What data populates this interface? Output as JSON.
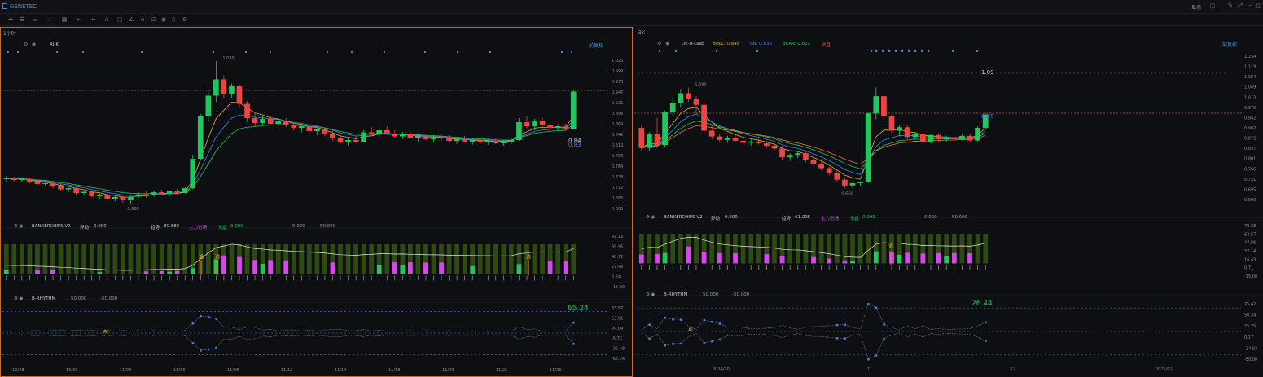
{
  "app": {
    "symbol": "GENETEC",
    "layout_label": "显示"
  },
  "left": {
    "interval": "1小时",
    "adjust": "前复权",
    "indicator_main": "AI-K",
    "high_label": "1.030",
    "low_label": "0.680",
    "price_labels": [
      "0.84",
      "0.83"
    ],
    "y_ticks": [
      "1.025",
      "0.999",
      "0.973",
      "0.947",
      "0.921",
      "0.895",
      "0.869",
      "0.842",
      "0.816",
      "0.790",
      "0.764",
      "0.738",
      "0.712",
      "0.686",
      "0.660"
    ],
    "sub1": {
      "name": "BANKERCHIPS-V2",
      "f1": "异动",
      "v1": "0.000",
      "f2": "趋势",
      "v2": "80.686",
      "f3": "主力进场",
      "f4": "洗盘",
      "v4": "0.000",
      "v5": "0.000",
      "v6": "50.000",
      "ticks": [
        "91.19",
        "69.95",
        "48.72",
        "27.48",
        "6.24",
        "-15.00"
      ],
      "escape": "逃"
    },
    "sub2": {
      "name": "B-RHYTHM",
      "v1": "50.000",
      "v2": "-50.000",
      "value": "65.24",
      "ticks": [
        "83.57",
        "53.01",
        "24.04",
        "-5.72",
        "-35.48",
        "-65.24"
      ],
      "ai": "AI"
    },
    "x_ticks": [
      "10/28",
      "10/30",
      "11/04",
      "11/06",
      "11/08",
      "11/12",
      "11/14",
      "11/18",
      "11/20",
      "11/22",
      "11/26"
    ],
    "chart_data": {
      "type": "candlestick",
      "ylim": [
        0.66,
        1.04
      ],
      "ohlc": [
        [
          0.74,
          0.748,
          0.735,
          0.742
        ],
        [
          0.742,
          0.746,
          0.735,
          0.738
        ],
        [
          0.738,
          0.745,
          0.732,
          0.74
        ],
        [
          0.74,
          0.744,
          0.73,
          0.733
        ],
        [
          0.733,
          0.738,
          0.725,
          0.728
        ],
        [
          0.728,
          0.735,
          0.722,
          0.73
        ],
        [
          0.73,
          0.734,
          0.718,
          0.722
        ],
        [
          0.722,
          0.728,
          0.712,
          0.715
        ],
        [
          0.715,
          0.722,
          0.708,
          0.718
        ],
        [
          0.718,
          0.72,
          0.702,
          0.706
        ],
        [
          0.706,
          0.712,
          0.7,
          0.709
        ],
        [
          0.709,
          0.712,
          0.695,
          0.698
        ],
        [
          0.698,
          0.705,
          0.69,
          0.702
        ],
        [
          0.702,
          0.706,
          0.688,
          0.692
        ],
        [
          0.692,
          0.7,
          0.685,
          0.696
        ],
        [
          0.696,
          0.702,
          0.682,
          0.688
        ],
        [
          0.688,
          0.7,
          0.68,
          0.697
        ],
        [
          0.697,
          0.708,
          0.692,
          0.703
        ],
        [
          0.703,
          0.71,
          0.695,
          0.7
        ],
        [
          0.7,
          0.712,
          0.696,
          0.708
        ],
        [
          0.708,
          0.714,
          0.7,
          0.704
        ],
        [
          0.704,
          0.712,
          0.698,
          0.71
        ],
        [
          0.71,
          0.716,
          0.702,
          0.706
        ],
        [
          0.706,
          0.72,
          0.704,
          0.718
        ],
        [
          0.718,
          0.8,
          0.715,
          0.79
        ],
        [
          0.79,
          0.9,
          0.785,
          0.895
        ],
        [
          0.895,
          0.96,
          0.88,
          0.945
        ],
        [
          0.945,
          1.03,
          0.93,
          0.985
        ],
        [
          0.985,
          0.995,
          0.94,
          0.95
        ],
        [
          0.95,
          0.975,
          0.94,
          0.968
        ],
        [
          0.968,
          0.972,
          0.915,
          0.925
        ],
        [
          0.925,
          0.932,
          0.88,
          0.89
        ],
        [
          0.89,
          0.905,
          0.87,
          0.878
        ],
        [
          0.878,
          0.895,
          0.87,
          0.888
        ],
        [
          0.888,
          0.895,
          0.872,
          0.876
        ],
        [
          0.876,
          0.888,
          0.865,
          0.882
        ],
        [
          0.882,
          0.89,
          0.868,
          0.872
        ],
        [
          0.872,
          0.88,
          0.86,
          0.866
        ],
        [
          0.866,
          0.875,
          0.855,
          0.87
        ],
        [
          0.87,
          0.875,
          0.852,
          0.858
        ],
        [
          0.858,
          0.866,
          0.848,
          0.862
        ],
        [
          0.862,
          0.865,
          0.845,
          0.85
        ],
        [
          0.85,
          0.858,
          0.835,
          0.84
        ],
        [
          0.84,
          0.848,
          0.825,
          0.83
        ],
        [
          0.83,
          0.84,
          0.822,
          0.836
        ],
        [
          0.836,
          0.845,
          0.828,
          0.832
        ],
        [
          0.832,
          0.86,
          0.83,
          0.855
        ],
        [
          0.855,
          0.868,
          0.845,
          0.85
        ],
        [
          0.85,
          0.866,
          0.842,
          0.86
        ],
        [
          0.86,
          0.87,
          0.848,
          0.852
        ],
        [
          0.852,
          0.86,
          0.84,
          0.845
        ],
        [
          0.845,
          0.856,
          0.838,
          0.852
        ],
        [
          0.852,
          0.858,
          0.838,
          0.842
        ],
        [
          0.842,
          0.85,
          0.832,
          0.846
        ],
        [
          0.846,
          0.852,
          0.835,
          0.838
        ],
        [
          0.838,
          0.848,
          0.83,
          0.842
        ],
        [
          0.842,
          0.85,
          0.834,
          0.84
        ],
        [
          0.84,
          0.848,
          0.83,
          0.834
        ],
        [
          0.834,
          0.842,
          0.826,
          0.838
        ],
        [
          0.838,
          0.846,
          0.83,
          0.832
        ],
        [
          0.832,
          0.84,
          0.825,
          0.836
        ],
        [
          0.836,
          0.842,
          0.826,
          0.83
        ],
        [
          0.83,
          0.838,
          0.824,
          0.834
        ],
        [
          0.834,
          0.84,
          0.826,
          0.828
        ],
        [
          0.828,
          0.836,
          0.822,
          0.832
        ],
        [
          0.832,
          0.84,
          0.826,
          0.836
        ],
        [
          0.836,
          0.89,
          0.834,
          0.88
        ],
        [
          0.88,
          0.895,
          0.865,
          0.87
        ],
        [
          0.87,
          0.888,
          0.86,
          0.884
        ],
        [
          0.884,
          0.892,
          0.866,
          0.872
        ],
        [
          0.872,
          0.88,
          0.86,
          0.866
        ],
        [
          0.866,
          0.875,
          0.858,
          0.87
        ],
        [
          0.87,
          0.876,
          0.86,
          0.864
        ],
        [
          0.864,
          0.96,
          0.862,
          0.955
        ]
      ]
    }
  },
  "right": {
    "interval": "日K",
    "adjust": "前复权",
    "indicator_main": "DE-A-LINE",
    "bull": "BULL: 0.848",
    "bb": "BB: 0.833",
    "bear": "BEAR: 0.822",
    "extra": "洗盘",
    "high_label": "1.090",
    "low_label": "0.660",
    "price_labels": [
      "1.09",
      "0.95"
    ],
    "y_ticks": [
      "1.154",
      "1.119",
      "1.084",
      "1.049",
      "1.013",
      "0.978",
      "0.942",
      "0.907",
      "0.872",
      "0.837",
      "0.801",
      "0.766",
      "0.731",
      "0.695",
      "0.660"
    ],
    "sub1": {
      "name": "BANKERCHIPS-V2",
      "f1": "异动",
      "v1": "0.000",
      "f2": "趋势",
      "v2": "61.205",
      "f3": "主力进场",
      "f4": "洗盘",
      "v4": "0.000",
      "v5": "0.000",
      "v6": "50.000",
      "ticks": [
        "79.28",
        "63.57",
        "47.86",
        "32.14",
        "16.43",
        "0.71",
        "-15.00"
      ],
      "escape": "逃"
    },
    "sub2": {
      "name": "B-RHYTHM",
      "v1": "50.000",
      "v2": "-50.000",
      "value": "26.44",
      "ticks": [
        "75.42",
        "50.34",
        "25.25",
        "0.17",
        "-24.92",
        "-50.00"
      ],
      "ai": "AI"
    },
    "x_ticks": [
      "2024/10",
      "11",
      "12",
      "2025/01"
    ],
    "chart_data": {
      "type": "candlestick",
      "ylim": [
        0.64,
        1.16
      ],
      "ohlc": [
        [
          0.9,
          0.91,
          0.82,
          0.83
        ],
        [
          0.83,
          0.885,
          0.82,
          0.878
        ],
        [
          0.878,
          0.935,
          0.83,
          0.84
        ],
        [
          0.84,
          0.96,
          0.835,
          0.955
        ],
        [
          0.955,
          1.01,
          0.94,
          0.985
        ],
        [
          0.985,
          1.035,
          0.97,
          1.02
        ],
        [
          1.02,
          1.04,
          0.99,
          1.0
        ],
        [
          1.0,
          1.01,
          0.95,
          0.98
        ],
        [
          0.98,
          0.99,
          0.88,
          0.89
        ],
        [
          0.89,
          0.91,
          0.86,
          0.87
        ],
        [
          0.87,
          0.88,
          0.85,
          0.858
        ],
        [
          0.858,
          0.872,
          0.848,
          0.865
        ],
        [
          0.865,
          0.876,
          0.85,
          0.855
        ],
        [
          0.855,
          0.862,
          0.84,
          0.848
        ],
        [
          0.848,
          0.86,
          0.838,
          0.852
        ],
        [
          0.852,
          0.862,
          0.842,
          0.846
        ],
        [
          0.846,
          0.856,
          0.83,
          0.838
        ],
        [
          0.838,
          0.846,
          0.822,
          0.828
        ],
        [
          0.828,
          0.836,
          0.79,
          0.798
        ],
        [
          0.798,
          0.812,
          0.785,
          0.806
        ],
        [
          0.806,
          0.82,
          0.795,
          0.812
        ],
        [
          0.812,
          0.818,
          0.78,
          0.79
        ],
        [
          0.79,
          0.798,
          0.768,
          0.775
        ],
        [
          0.775,
          0.782,
          0.752,
          0.76
        ],
        [
          0.76,
          0.766,
          0.735,
          0.742
        ],
        [
          0.742,
          0.75,
          0.712,
          0.72
        ],
        [
          0.72,
          0.728,
          0.69,
          0.7
        ],
        [
          0.7,
          0.712,
          0.69,
          0.708
        ],
        [
          0.708,
          0.715,
          0.698,
          0.712
        ],
        [
          0.712,
          0.955,
          0.708,
          0.95
        ],
        [
          0.95,
          1.04,
          0.93,
          1.01
        ],
        [
          1.01,
          1.02,
          0.93,
          0.94
        ],
        [
          0.94,
          0.948,
          0.88,
          0.89
        ],
        [
          0.89,
          0.91,
          0.87,
          0.902
        ],
        [
          0.902,
          0.912,
          0.86,
          0.868
        ],
        [
          0.868,
          0.885,
          0.858,
          0.88
        ],
        [
          0.88,
          0.895,
          0.84,
          0.85
        ],
        [
          0.85,
          0.88,
          0.845,
          0.875
        ],
        [
          0.875,
          0.882,
          0.852,
          0.86
        ],
        [
          0.86,
          0.872,
          0.852,
          0.866
        ],
        [
          0.866,
          0.874,
          0.854,
          0.86
        ],
        [
          0.86,
          0.88,
          0.856,
          0.872
        ],
        [
          0.872,
          0.88,
          0.85,
          0.856
        ],
        [
          0.856,
          0.905,
          0.852,
          0.9
        ],
        [
          0.9,
          0.95,
          0.895,
          0.946
        ]
      ]
    }
  }
}
